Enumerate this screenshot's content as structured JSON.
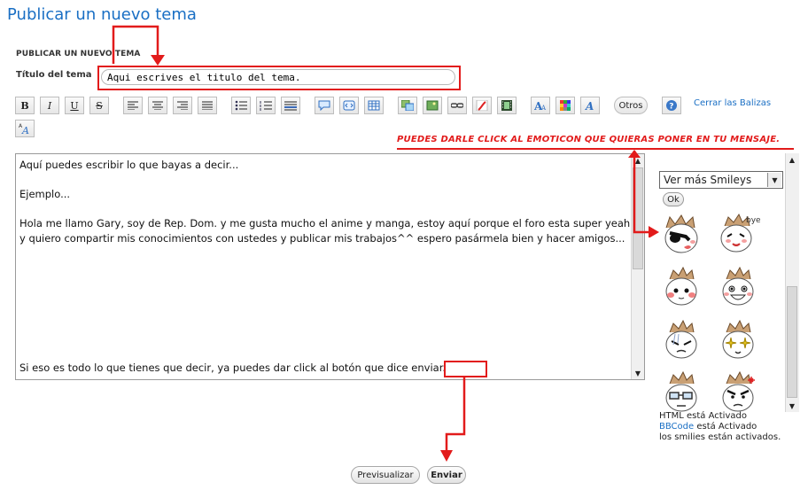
{
  "page": {
    "title": "Publicar un nuevo tema",
    "section_heading": "PUBLICAR UN NUEVO TEMA",
    "title_label": "Título del tema",
    "title_value": "Aqui escrives el titulo del tema."
  },
  "toolbar": {
    "bold": "B",
    "italic": "I",
    "underline": "U",
    "strike": "S",
    "others_label": "Otros",
    "close_tags_link": "Cerrar las Balizas",
    "font_size_label": "A"
  },
  "annotations": {
    "emoticon_hint": "PUEDES DARLE CLICK AL EMOTICON QUE QUIERAS PONER EN TU MENSAJE.",
    "accent_color": "#e21b1b"
  },
  "editor": {
    "lines": [
      "Aquí puedes escribir lo que bayas a decir...",
      "",
      "Ejemplo...",
      "",
      "Hola me llamo Gary, soy de Rep. Dom. y me gusta mucho el anime y manga, estoy aquí porque el foro esta super yeah y quiero compartir mis conocimientos con ustedes y publicar mis trabajos^^ espero pasármela bien y hacer amigos..."
    ],
    "last_line_prefix": "Si eso es todo lo que tienes que decir, ya puedes dar click al botón que dice ",
    "last_line_highlight": "enviar."
  },
  "smileys": {
    "select_value": "Ver más Smileys",
    "ok_label": "Ok",
    "bye_text": "bye"
  },
  "status": {
    "html_prefix": "HTML está Activado",
    "bbcode_link": "BBCode",
    "bbcode_suffix": " está Activado",
    "smilies": "los smilies están activados."
  },
  "buttons": {
    "preview": "Previsualizar",
    "send": "Enviar"
  }
}
